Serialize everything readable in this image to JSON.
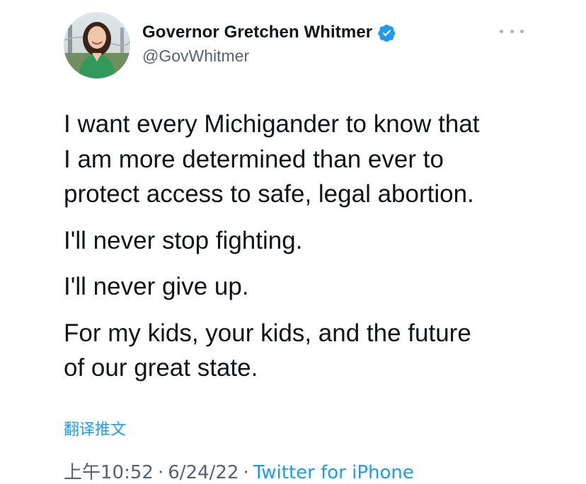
{
  "author": {
    "display_name": "Governor Gretchen Whitmer",
    "handle": "@GovWhitmer",
    "verified": true,
    "avatar_icon": "profile-photo"
  },
  "tweet": {
    "paragraphs": [
      [
        "I want every Michigander to know that",
        "I am more determined than ever to",
        "protect access to safe, legal abortion."
      ],
      [
        "I'll never stop fighting."
      ],
      [
        "I'll never give up."
      ],
      [
        "For my kids, your kids, and the future",
        "of our great state."
      ]
    ]
  },
  "translate_label": "翻译推文",
  "meta": {
    "time": "上午10:52",
    "date": "6/24/22",
    "separator": "·",
    "source": "Twitter for iPhone"
  },
  "colors": {
    "link": "#1d9bf0",
    "secondary_text": "#536471",
    "primary_text": "#0f1419",
    "verified_badge": "#1d9bf0"
  },
  "icons": {
    "more": "more-horizontal-icon",
    "verified": "verified-badge-icon"
  }
}
